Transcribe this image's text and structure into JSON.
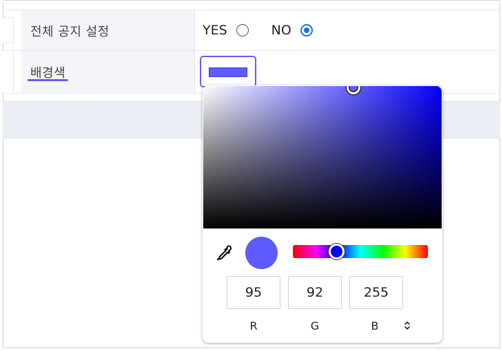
{
  "form": {
    "notice_row": {
      "label": "전체 공지 설정",
      "yes_label": "YES",
      "no_label": "NO",
      "selected": "NO"
    },
    "bg_color_row": {
      "label": "배경색",
      "current_color": "#5f5cff"
    }
  },
  "picker": {
    "hue_color": "#0400ff",
    "preview_color": "#5f5cff",
    "rgb": {
      "r": "95",
      "g": "92",
      "b": "255"
    },
    "labels": {
      "r": "R",
      "g": "G",
      "b": "B"
    },
    "hue_level": 0.32,
    "icons": [
      "eyedropper-icon",
      "chevron-up-down-icon"
    ]
  },
  "colors": {
    "accent": "#6a5cf2",
    "radio_checked": "#1a73e8",
    "table_label_bg": "#f4f5f9",
    "band_bg": "#eceef5"
  }
}
